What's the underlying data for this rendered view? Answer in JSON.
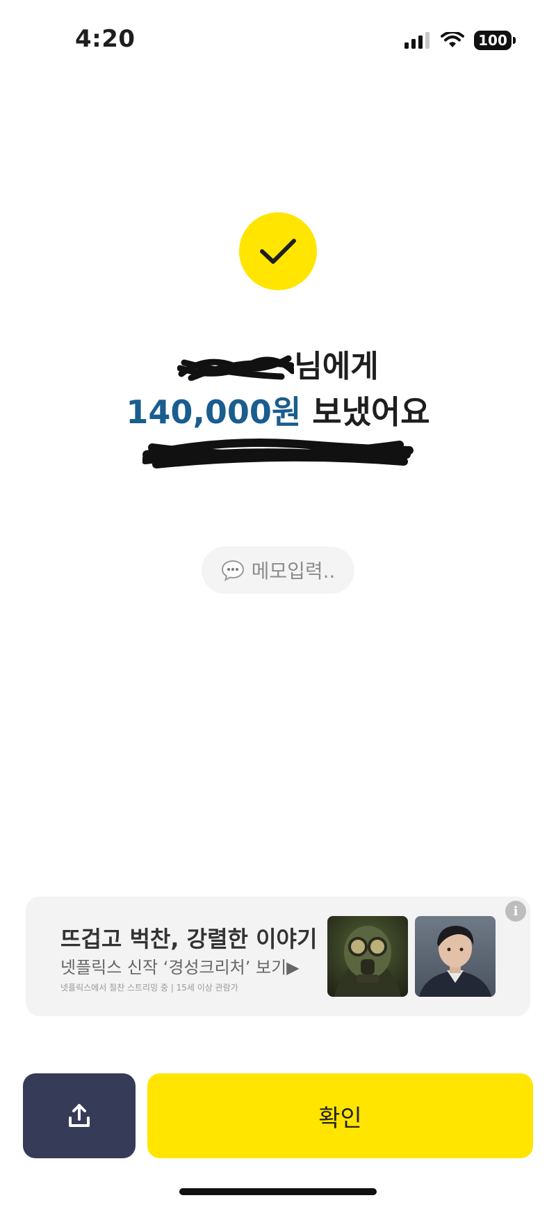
{
  "status_bar": {
    "time": "4:20",
    "battery": "100"
  },
  "result": {
    "recipient_suffix": "님에게",
    "amount": "140,000원",
    "sent_text": " 보냈어요"
  },
  "memo": {
    "label": "메모입력.."
  },
  "ad": {
    "title": "뜨겁고 벅찬, 강렬한 이야기",
    "subtitle": "넷플릭스 신작 ‘경성크리처’ 보기▶",
    "fine_print": "넷플릭스에서 절찬 스트리밍 중 | 15세 이상 관람가",
    "info": "i"
  },
  "actions": {
    "confirm_label": "확인"
  },
  "colors": {
    "accent": "#ffe500",
    "amount": "#1a5d8f",
    "share_button": "#363b58"
  },
  "icons": [
    "cellular-icon",
    "wifi-icon",
    "battery-icon",
    "check-icon",
    "speech-bubble-icon",
    "info-icon",
    "share-icon"
  ]
}
